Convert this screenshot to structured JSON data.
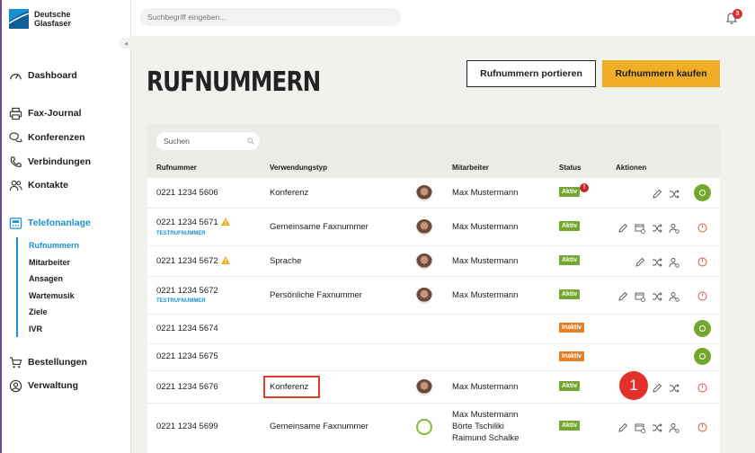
{
  "brand": {
    "line1": "Deutsche",
    "line2": "Glasfaser"
  },
  "topbar": {
    "search_placeholder": "Suchbegriff eingeben...",
    "notifications": "3"
  },
  "sidebar": {
    "items": [
      {
        "label": "Dashboard",
        "icon": "speedometer-icon"
      },
      {
        "label": "Fax-Journal",
        "icon": "printer-icon"
      },
      {
        "label": "Konferenzen",
        "icon": "chat-bubbles-icon"
      },
      {
        "label": "Verbindungen",
        "icon": "phone-icon"
      },
      {
        "label": "Kontakte",
        "icon": "contacts-icon"
      },
      {
        "label": "Telefonanlage",
        "icon": "phone-system-icon"
      },
      {
        "label": "Bestellungen",
        "icon": "cart-icon"
      },
      {
        "label": "Verwaltung",
        "icon": "user-circle-icon"
      }
    ],
    "subitems": [
      "Rufnummern",
      "Mitarbeiter",
      "Ansagen",
      "Wartemusik",
      "Ziele",
      "IVR"
    ]
  },
  "page": {
    "title": "RUFNUMMERN",
    "btn_port": "Rufnummern portieren",
    "btn_buy": "Rufnummern kaufen"
  },
  "table": {
    "search_placeholder": "Suchen",
    "headers": [
      "Rufnummer",
      "Verwendungstyp",
      "Mitarbeiter",
      "Status",
      "Aktionen"
    ],
    "rows": [
      {
        "number": "0221 1234 5606",
        "tag": "",
        "type": "Konferenz",
        "employees": [
          "Max Mustermann"
        ],
        "status": "Aktiv"
      },
      {
        "number": "0221 1234 5671",
        "tag": "TESTRUFNUMMER",
        "type": "Gemeinsame Faxnummer",
        "employees": [
          "Max Mustermann"
        ],
        "status": "Aktiv"
      },
      {
        "number": "0221 1234 5672",
        "tag": "",
        "type": "Sprache",
        "employees": [
          "Max Mustermann"
        ],
        "status": "Aktiv"
      },
      {
        "number": "0221 1234 5672",
        "tag": "TESTRUFNUMMER",
        "type": "Persönliche Faxnummer",
        "employees": [
          "Max Mustermann"
        ],
        "status": "Aktiv"
      },
      {
        "number": "0221 1234 5674",
        "tag": "",
        "type": "",
        "employees": [],
        "status": "Inaktiv"
      },
      {
        "number": "0221 1234 5675",
        "tag": "",
        "type": "",
        "employees": [],
        "status": "Inaktiv"
      },
      {
        "number": "0221 1234 5676",
        "tag": "",
        "type": "Konferenz",
        "employees": [
          "Max Mustermann"
        ],
        "status": "Aktiv"
      },
      {
        "number": "0221 1234 5699",
        "tag": "",
        "type": "Gemeinsame Faxnummer",
        "employees": [
          "Max Mustermann",
          "Börte Tschiliki",
          "Raimund Schalke"
        ],
        "status": "Aktiv"
      }
    ],
    "status_alert": "!"
  },
  "annotation": {
    "step": "1"
  },
  "colors": {
    "accent": "#1a90d1",
    "buy": "#f0ad26",
    "active": "#74a72e",
    "inactive": "#e58024",
    "alert": "#e2312a"
  }
}
